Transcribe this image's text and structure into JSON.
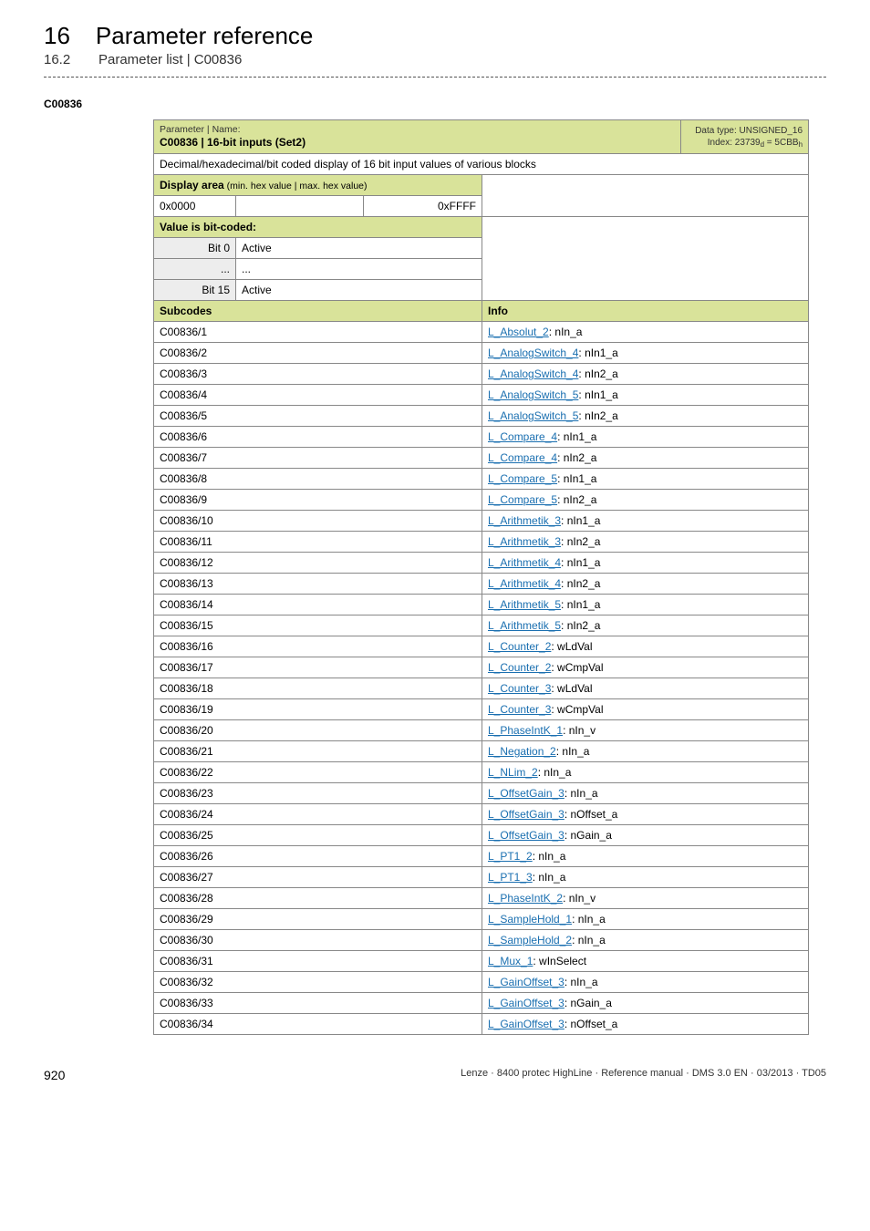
{
  "header": {
    "chapter_no": "16",
    "chapter_title": "Parameter reference",
    "section_no": "16.2",
    "section_title": "Parameter list | C00836"
  },
  "anchor": "C00836",
  "titlecell": {
    "small": "Parameter | Name:",
    "main": "C00836 | 16-bit inputs (Set2)"
  },
  "titlecell_right": {
    "line1": "Data type: UNSIGNED_16",
    "line2_pre": "Index: 23739",
    "line2_sub1": "d",
    "line2_mid": " = 5CBB",
    "line2_sub2": "h"
  },
  "description": "Decimal/hexadecimal/bit coded display of 16 bit input values of various blocks",
  "display_area": {
    "label": "Display area",
    "suffix": " (min. hex value | max. hex value)",
    "min": "0x0000",
    "max": "0xFFFF"
  },
  "bitcoded": {
    "label": "Value is bit-coded:",
    "rows": [
      {
        "bit": "Bit 0",
        "val": "Active"
      },
      {
        "bit": "...",
        "val": "..."
      },
      {
        "bit": "Bit 15",
        "val": "Active"
      }
    ]
  },
  "subcodes_header": {
    "left": "Subcodes",
    "right": "Info"
  },
  "rows": [
    {
      "sub": "C00836/1",
      "link": "L_Absolut_2",
      "rest": ": nIn_a"
    },
    {
      "sub": "C00836/2",
      "link": "L_AnalogSwitch_4",
      "rest": ": nIn1_a"
    },
    {
      "sub": "C00836/3",
      "link": "L_AnalogSwitch_4",
      "rest": ": nIn2_a"
    },
    {
      "sub": "C00836/4",
      "link": "L_AnalogSwitch_5",
      "rest": ": nIn1_a"
    },
    {
      "sub": "C00836/5",
      "link": "L_AnalogSwitch_5",
      "rest": ": nIn2_a"
    },
    {
      "sub": "C00836/6",
      "link": "L_Compare_4",
      "rest": ": nIn1_a"
    },
    {
      "sub": "C00836/7",
      "link": "L_Compare_4",
      "rest": ": nIn2_a"
    },
    {
      "sub": "C00836/8",
      "link": "L_Compare_5",
      "rest": ": nIn1_a"
    },
    {
      "sub": "C00836/9",
      "link": "L_Compare_5",
      "rest": ": nIn2_a"
    },
    {
      "sub": "C00836/10",
      "link": "L_Arithmetik_3",
      "rest": ": nIn1_a"
    },
    {
      "sub": "C00836/11",
      "link": "L_Arithmetik_3",
      "rest": ": nIn2_a"
    },
    {
      "sub": "C00836/12",
      "link": "L_Arithmetik_4",
      "rest": ": nIn1_a"
    },
    {
      "sub": "C00836/13",
      "link": "L_Arithmetik_4",
      "rest": ": nIn2_a"
    },
    {
      "sub": "C00836/14",
      "link": "L_Arithmetik_5",
      "rest": ": nIn1_a"
    },
    {
      "sub": "C00836/15",
      "link": "L_Arithmetik_5",
      "rest": ": nIn2_a"
    },
    {
      "sub": "C00836/16",
      "link": "L_Counter_2",
      "rest": ": wLdVal"
    },
    {
      "sub": "C00836/17",
      "link": "L_Counter_2",
      "rest": ": wCmpVal"
    },
    {
      "sub": "C00836/18",
      "link": "L_Counter_3",
      "rest": ": wLdVal"
    },
    {
      "sub": "C00836/19",
      "link": "L_Counter_3",
      "rest": ": wCmpVal"
    },
    {
      "sub": "C00836/20",
      "link": "L_PhaseIntK_1",
      "rest": ": nIn_v"
    },
    {
      "sub": "C00836/21",
      "link": "L_Negation_2",
      "rest": ": nIn_a"
    },
    {
      "sub": "C00836/22",
      "link": "L_NLim_2",
      "rest": ": nIn_a"
    },
    {
      "sub": "C00836/23",
      "link": "L_OffsetGain_3",
      "rest": ": nIn_a"
    },
    {
      "sub": "C00836/24",
      "link": "L_OffsetGain_3",
      "rest": ": nOffset_a"
    },
    {
      "sub": "C00836/25",
      "link": "L_OffsetGain_3",
      "rest": ": nGain_a"
    },
    {
      "sub": "C00836/26",
      "link": "L_PT1_2",
      "rest": ": nIn_a"
    },
    {
      "sub": "C00836/27",
      "link": "L_PT1_3",
      "rest": ": nIn_a"
    },
    {
      "sub": "C00836/28",
      "link": "L_PhaseIntK_2",
      "rest": ": nIn_v"
    },
    {
      "sub": "C00836/29",
      "link": "L_SampleHold_1",
      "rest": ": nIn_a"
    },
    {
      "sub": "C00836/30",
      "link": "L_SampleHold_2",
      "rest": ": nIn_a"
    },
    {
      "sub": "C00836/31",
      "link": "L_Mux_1",
      "rest": ": wInSelect"
    },
    {
      "sub": "C00836/32",
      "link": "L_GainOffset_3",
      "rest": ": nIn_a"
    },
    {
      "sub": "C00836/33",
      "link": "L_GainOffset_3",
      "rest": ": nGain_a"
    },
    {
      "sub": "C00836/34",
      "link": "L_GainOffset_3",
      "rest": ": nOffset_a"
    }
  ],
  "footer": {
    "page": "920",
    "right": "Lenze · 8400 protec HighLine · Reference manual · DMS 3.0 EN · 03/2013 · TD05"
  }
}
